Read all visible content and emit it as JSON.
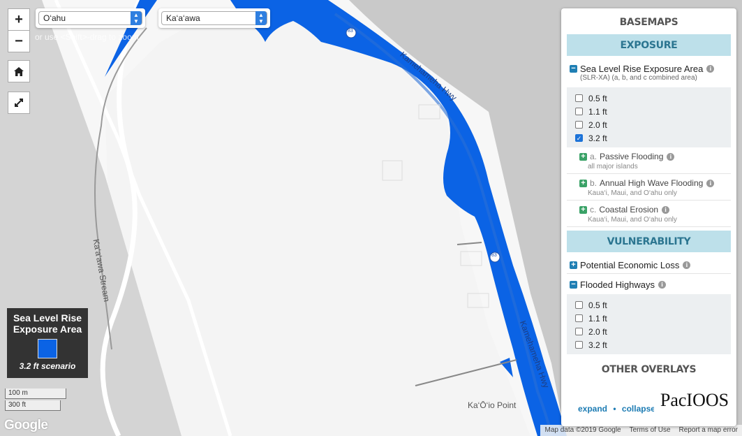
{
  "map": {
    "island_select": "O‘ahu",
    "location_select": "Ka‘a‘awa",
    "hint": "or use <Shift>-drag to zoom",
    "zoom_in": "+",
    "zoom_out": "−",
    "labels": {
      "highway_1": "Kamehameha Hwy",
      "highway_2": "Kamehameha Hwy",
      "route_1": "83",
      "route_2": "83",
      "route_3": "83",
      "stream": "Ka‘a‘awa Stream",
      "point": "Ka‘Ō‘io Point"
    },
    "colors": {
      "exposure": "#0b63e5",
      "land": "#f7f7f7",
      "water": "#c9c9c9"
    }
  },
  "legend": {
    "title_line1": "Sea Level Rise",
    "title_line2": "Exposure Area",
    "scenario": "3.2 ft scenario"
  },
  "scale": {
    "metric": "100 m",
    "imperial": "300 ft"
  },
  "google_logo": "Google",
  "attribution": {
    "map_data": "Map data ©2019 Google",
    "terms": "Terms of Use",
    "report": "Report a map error"
  },
  "panel": {
    "basemaps": "BASEMAPS",
    "exposure": "EXPOSURE",
    "slr": {
      "label": "Sea Level Rise Exposure Area",
      "sub": "(SLR-XA) (a, b, and c combined area)",
      "options": [
        {
          "label": "0.5 ft",
          "checked": false
        },
        {
          "label": "1.1 ft",
          "checked": false
        },
        {
          "label": "2.0 ft",
          "checked": false
        },
        {
          "label": "3.2 ft",
          "checked": true
        }
      ],
      "sublayers": [
        {
          "letter": "a.",
          "name": "Passive Flooding",
          "desc": "all major islands"
        },
        {
          "letter": "b.",
          "name": "Annual High Wave Flooding",
          "desc": "Kaua‘i, Maui, and O‘ahu only"
        },
        {
          "letter": "c.",
          "name": "Coastal Erosion",
          "desc": "Kaua‘i, Maui, and O‘ahu only"
        }
      ]
    },
    "vulnerability": "VULNERABILITY",
    "economic_loss": "Potential Economic Loss",
    "flooded_highways": {
      "label": "Flooded Highways",
      "options": [
        {
          "label": "0.5 ft",
          "checked": false
        },
        {
          "label": "1.1 ft",
          "checked": false
        },
        {
          "label": "2.0 ft",
          "checked": false
        },
        {
          "label": "3.2 ft",
          "checked": false
        }
      ]
    },
    "other_overlays": "OTHER OVERLAYS",
    "expand": "expand",
    "separator": "•",
    "collapse": "collapse",
    "logo": "PacIOOS"
  }
}
